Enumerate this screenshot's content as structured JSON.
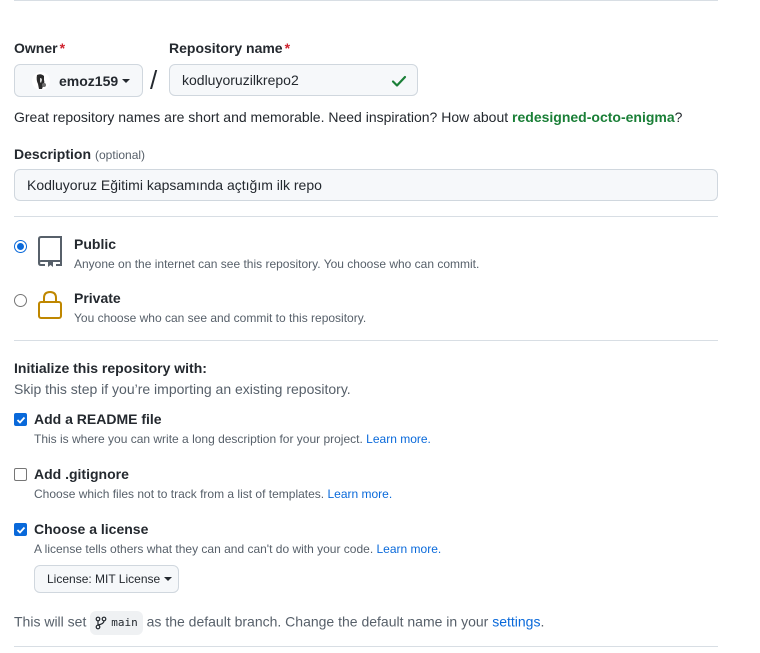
{
  "owner": {
    "label": "Owner",
    "required_mark": "*",
    "value": "emoz159"
  },
  "separator": "/",
  "repo": {
    "label": "Repository name",
    "required_mark": "*",
    "value": "kodluyoruzilkrepo2",
    "valid": true
  },
  "hint": {
    "text": "Great repository names are short and memorable. Need inspiration? How about",
    "suggestion": "redesigned-octo-enigma",
    "end": "?"
  },
  "description": {
    "label": "Description",
    "optional": "(optional)",
    "value": "Kodluyoruz Eğitimi kapsamında açtığım ilk repo"
  },
  "visibility": {
    "selected": "public",
    "public": {
      "title": "Public",
      "desc": "Anyone on the internet can see this repository. You choose who can commit."
    },
    "private": {
      "title": "Private",
      "desc": "You choose who can see and commit to this repository."
    }
  },
  "init": {
    "title": "Initialize this repository with:",
    "subtitle": "Skip this step if you’re importing an existing repository.",
    "readme": {
      "checked": true,
      "label": "Add a README file",
      "desc": "This is where you can write a long description for your project.",
      "link": "Learn more."
    },
    "gitignore": {
      "checked": false,
      "label": "Add .gitignore",
      "desc": "Choose which files not to track from a list of templates.",
      "link": "Learn more."
    },
    "license": {
      "checked": true,
      "label": "Choose a license",
      "desc": "A license tells others what they can and can't do with your code.",
      "link": "Learn more.",
      "select_label": "License: MIT License"
    }
  },
  "branch": {
    "prefix": "This will set",
    "name": "main",
    "suffix": "as the default branch. Change the default name in your",
    "link": "settings",
    "end": "."
  },
  "colors": {
    "accent": "#0969da",
    "success": "#1a7f37",
    "danger": "#cf222e",
    "lock": "#bf8700"
  }
}
